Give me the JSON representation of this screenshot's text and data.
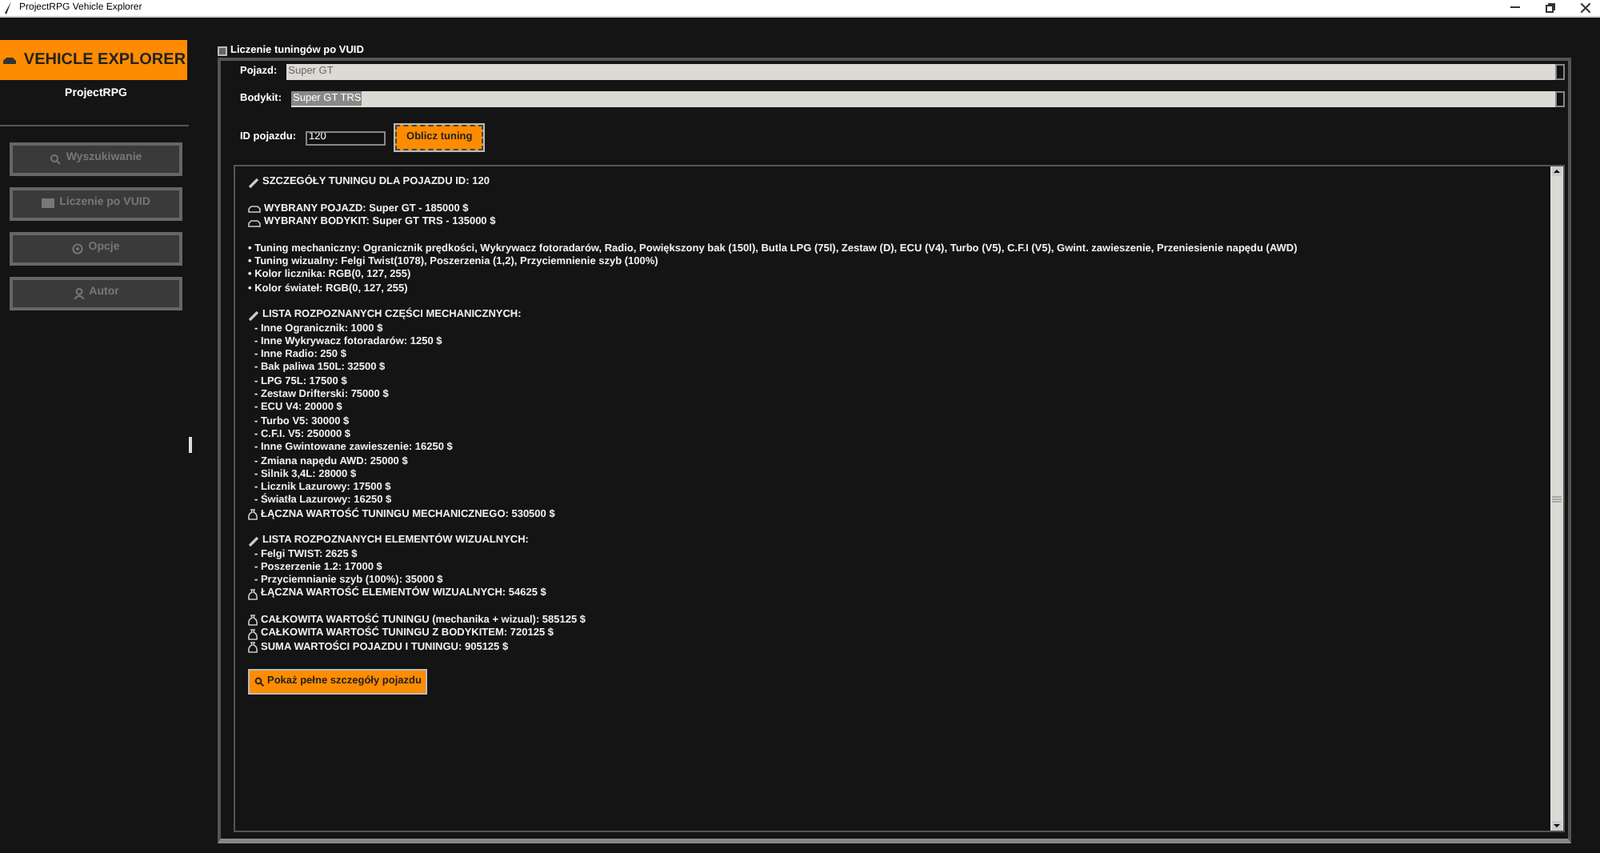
{
  "window": {
    "title": "ProjectRPG Vehicle Explorer"
  },
  "sidebar": {
    "logo": "VEHICLE EXPLORER",
    "subtitle": "ProjectRPG",
    "items": [
      {
        "label": "Wyszukiwanie",
        "disabled": true
      },
      {
        "label": "Liczenie po VUID",
        "disabled": true
      },
      {
        "label": "Opcje",
        "disabled": true
      },
      {
        "label": "Autor",
        "disabled": true
      }
    ]
  },
  "tab": {
    "label": "Liczenie tuningów po VUID"
  },
  "form": {
    "vehicle_label": "Pojazd:",
    "vehicle_value": "Super GT",
    "bodykit_label": "Bodykit:",
    "bodykit_value": "Super GT TRS",
    "id_label": "ID pojazdu:",
    "id_value": "120",
    "calc_button": "Oblicz tuning"
  },
  "details": {
    "lines": [
      {
        "kind": "section",
        "text": "SZCZEGÓŁY TUNINGU DLA POJAZDU ID: 120"
      },
      {
        "kind": "blank"
      },
      {
        "kind": "vehicle",
        "text": "WYBRANY POJAZD: Super GT - 185000 $"
      },
      {
        "kind": "vehicle",
        "text": "WYBRANY BODYKIT: Super GT TRS - 135000 $"
      },
      {
        "kind": "blank"
      },
      {
        "kind": "text",
        "text": "• Tuning mechaniczny: Ogranicznik prędkości, Wykrywacz fotoradarów, Radio, Powiększony bak (150l), Butla LPG (75l), Zestaw (D), ECU (V4), Turbo (V5), C.F.I (V5), Gwint. zawieszenie, Przeniesienie napędu (AWD)"
      },
      {
        "kind": "text",
        "text": "• Tuning wizualny: Felgi Twist(1078), Poszerzenia (1,2), Przyciemnienie szyb (100%)"
      },
      {
        "kind": "text",
        "text": "• Kolor licznika: RGB(0, 127, 255)"
      },
      {
        "kind": "text",
        "text": "• Kolor świateł: RGB(0, 127, 255)"
      },
      {
        "kind": "blank"
      },
      {
        "kind": "section",
        "text": "LISTA ROZPOZNANYCH CZĘŚCI MECHANICZNYCH:"
      },
      {
        "kind": "item",
        "text": "- Inne Ogranicznik: 1000 $"
      },
      {
        "kind": "item",
        "text": "- Inne Wykrywacz fotoradarów: 1250 $"
      },
      {
        "kind": "item",
        "text": "- Inne Radio: 250 $"
      },
      {
        "kind": "item",
        "text": "- Bak paliwa 150L: 32500 $"
      },
      {
        "kind": "item",
        "text": "- LPG 75L: 17500 $"
      },
      {
        "kind": "item",
        "text": "- Zestaw Drifterski: 75000 $"
      },
      {
        "kind": "item",
        "text": "- ECU V4: 20000 $"
      },
      {
        "kind": "item",
        "text": "- Turbo V5: 30000 $"
      },
      {
        "kind": "item",
        "text": "- C.F.I. V5: 250000 $"
      },
      {
        "kind": "item",
        "text": "- Inne Gwintowane zawieszenie: 16250 $"
      },
      {
        "kind": "item",
        "text": "- Zmiana napędu AWD: 25000 $"
      },
      {
        "kind": "item",
        "text": "- Silnik 3,4L: 28000 $"
      },
      {
        "kind": "item",
        "text": "- Licznik Lazurowy: 17500 $"
      },
      {
        "kind": "item",
        "text": "- Światła Lazurowy: 16250 $"
      },
      {
        "kind": "total",
        "text": "ŁĄCZNA WARTOŚĆ TUNINGU MECHANICZNEGO: 530500 $"
      },
      {
        "kind": "blank"
      },
      {
        "kind": "section",
        "text": "LISTA ROZPOZNANYCH ELEMENTÓW WIZUALNYCH:"
      },
      {
        "kind": "item",
        "text": "- Felgi TWIST: 2625 $"
      },
      {
        "kind": "item",
        "text": "- Poszerzenie 1.2: 17000 $"
      },
      {
        "kind": "item",
        "text": "- Przyciemnianie szyb (100%): 35000 $"
      },
      {
        "kind": "total",
        "text": "ŁĄCZNA WARTOŚĆ ELEMENTÓW WIZUALNYCH: 54625 $"
      },
      {
        "kind": "blank"
      },
      {
        "kind": "total",
        "text": "CAŁKOWITA WARTOŚĆ TUNINGU (mechanika + wizual): 585125 $"
      },
      {
        "kind": "total",
        "text": "CAŁKOWITA WARTOŚĆ TUNINGU Z BODYKITEM: 720125 $"
      },
      {
        "kind": "total",
        "text": "SUMA WARTOŚCI POJAZDU I TUNINGU: 905125 $"
      }
    ],
    "button": "Pokaż pełne szczegóły pojazdu"
  }
}
